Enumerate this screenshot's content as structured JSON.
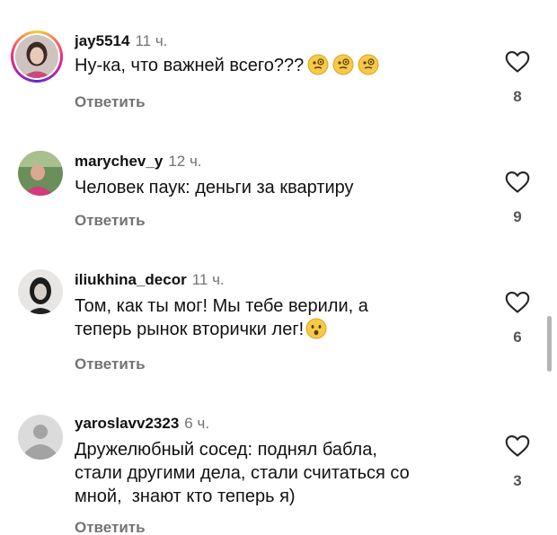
{
  "comments": [
    {
      "username": "jay5514",
      "time": "11 ч.",
      "lines": [
        "Ну-ка, что важней всего???"
      ],
      "emoji": "thinking-face-emoji x3",
      "reply_label": "Ответить",
      "likes": "8"
    },
    {
      "username": "marychev_y",
      "time": "12 ч.",
      "lines": [
        "Человек паук: деньги за квартиру"
      ],
      "reply_label": "Ответить",
      "likes": "9"
    },
    {
      "username": "iliukhina_decor",
      "time": "11 ч.",
      "lines": [
        "Том, как ты мог! Мы тебе верили, а",
        "теперь рынок вторички лег!"
      ],
      "emoji": "hushed-face-emoji",
      "reply_label": "Ответить",
      "likes": "6"
    },
    {
      "username": "yaroslavv2323",
      "time": "6 ч.",
      "lines": [
        "Дружелюбный сосед: поднял бабла,",
        "стали другими дела, стали считаться со",
        "мной,  знают кто теперь я)"
      ],
      "reply_label": "Ответить",
      "likes": "3"
    }
  ],
  "colors": {
    "text": "#111111",
    "secondary": "#737373",
    "story_ring_start": "#f9ce34",
    "story_ring_mid": "#ee2a7b"
  }
}
